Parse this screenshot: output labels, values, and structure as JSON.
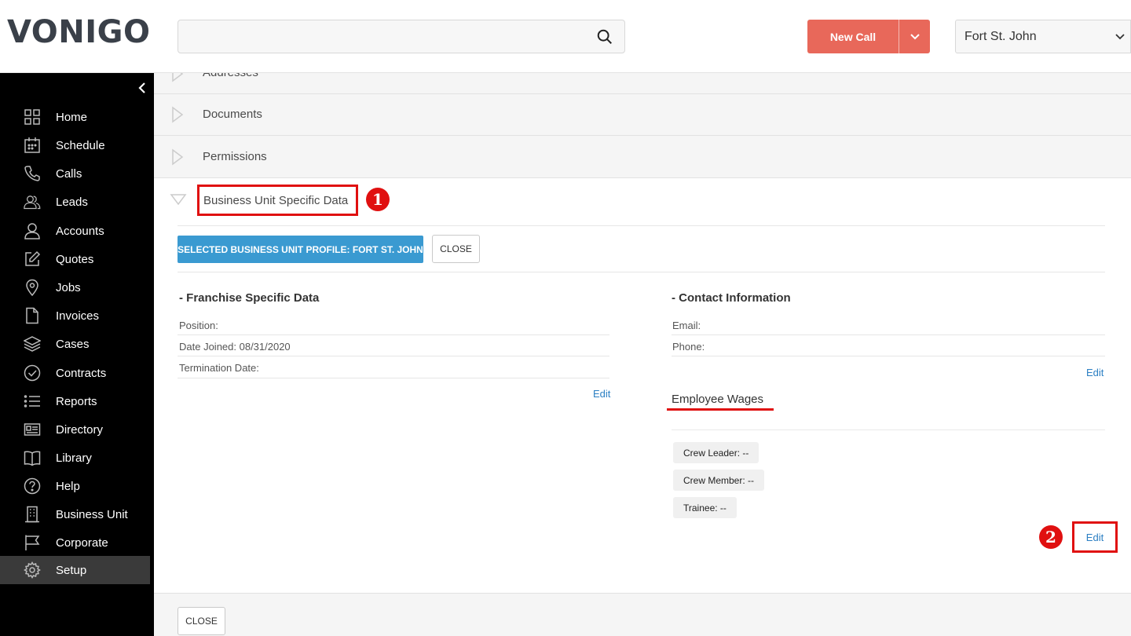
{
  "header": {
    "logo": "VONIGO",
    "search": {
      "value": "",
      "placeholder": ""
    },
    "new_call_label": "New Call",
    "location": "Fort St. John"
  },
  "sidebar": {
    "items": [
      {
        "label": "Home",
        "icon": "grid-icon"
      },
      {
        "label": "Schedule",
        "icon": "calendar-icon"
      },
      {
        "label": "Calls",
        "icon": "phone-icon"
      },
      {
        "label": "Leads",
        "icon": "users-icon"
      },
      {
        "label": "Accounts",
        "icon": "user-icon"
      },
      {
        "label": "Quotes",
        "icon": "edit-icon"
      },
      {
        "label": "Jobs",
        "icon": "map-pin-icon"
      },
      {
        "label": "Invoices",
        "icon": "file-icon"
      },
      {
        "label": "Cases",
        "icon": "layers-icon"
      },
      {
        "label": "Contracts",
        "icon": "check-circle-icon"
      },
      {
        "label": "Reports",
        "icon": "list-icon"
      },
      {
        "label": "Directory",
        "icon": "id-card-icon"
      },
      {
        "label": "Library",
        "icon": "book-icon"
      },
      {
        "label": "Help",
        "icon": "help-circle-icon"
      },
      {
        "label": "Business Unit",
        "icon": "building-icon"
      },
      {
        "label": "Corporate",
        "icon": "flag-icon"
      },
      {
        "label": "Setup",
        "icon": "gear-icon",
        "active": true
      }
    ]
  },
  "accordion": {
    "addresses": "Addresses",
    "documents": "Documents",
    "permissions": "Permissions",
    "business_unit": "Business Unit Specific Data"
  },
  "markers": {
    "one": "1",
    "two": "2"
  },
  "bu_section": {
    "selected_profile_label": "SELECTED BUSINESS UNIT PROFILE: FORT ST. JOHN",
    "close_label": "CLOSE",
    "franchise": {
      "title": "- Franchise Specific Data",
      "position": "Position:",
      "date_joined": "Date Joined: 08/31/2020",
      "termination": "Termination Date:",
      "edit": "Edit"
    },
    "contact": {
      "title": "- Contact Information",
      "email": "Email:",
      "phone": "Phone:",
      "edit": "Edit"
    },
    "wages": {
      "title": "Employee Wages",
      "items": [
        "Crew Leader: --",
        "Crew Member: --",
        "Trainee: --"
      ],
      "edit": "Edit"
    }
  },
  "footer": {
    "close_label": "CLOSE"
  },
  "colors": {
    "accent_red": "#e8685a",
    "primary_blue": "#3a9ad1",
    "highlight_red": "#e01010",
    "link_blue": "#2b7fc3"
  }
}
